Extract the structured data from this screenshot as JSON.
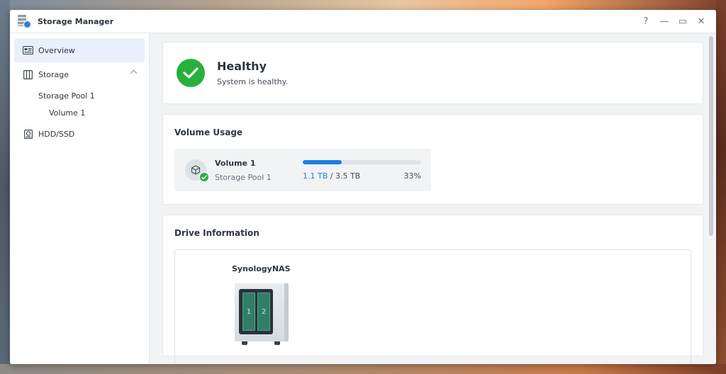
{
  "window": {
    "title": "Storage Manager"
  },
  "controls": {
    "help": "?",
    "minimize": "—",
    "maximize": "▭",
    "close": "✕"
  },
  "sidebar": {
    "overview": "Overview",
    "storage": "Storage",
    "storage_pool": "Storage Pool 1",
    "volume": "Volume 1",
    "hdd": "HDD/SSD"
  },
  "health": {
    "status": "Healthy",
    "message": "System is healthy."
  },
  "usage": {
    "title": "Volume Usage",
    "volume_name": "Volume 1",
    "pool_name": "Storage Pool 1",
    "used": "1.1 TB",
    "separator": " / ",
    "total": "3.5 TB",
    "percent_label": "33%",
    "percent": 33
  },
  "drive": {
    "title": "Drive Information",
    "nas_name": "SynologyNAS",
    "bays": [
      "1",
      "2"
    ]
  },
  "colors": {
    "accent": "#1b7fe0",
    "healthy": "#27b03c",
    "bay": "#2f7f66"
  }
}
